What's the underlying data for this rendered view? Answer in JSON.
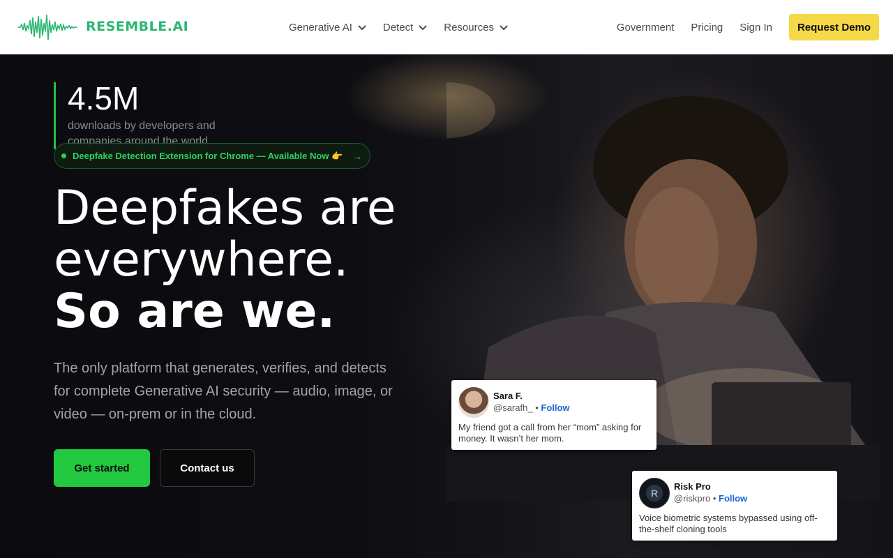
{
  "brand": {
    "name": "RESEMBLE.AI",
    "color": "#2bb673"
  },
  "nav": {
    "left": [
      {
        "label": "Generative AI",
        "has_dropdown": true
      },
      {
        "label": "Detect",
        "has_dropdown": true
      },
      {
        "label": "Resources",
        "has_dropdown": true
      }
    ],
    "right": [
      {
        "label": "Government"
      },
      {
        "label": "Pricing"
      },
      {
        "label": "Sign In"
      }
    ],
    "cta": {
      "label": "Request Demo",
      "color": "#f5d947"
    }
  },
  "hero": {
    "stat": {
      "value": "4.5M",
      "description": "downloads by developers and companies around the world"
    },
    "pill": {
      "text": "Deepfake Detection Extension for Chrome — Available Now 👉",
      "arrow": "→"
    },
    "headline": {
      "line1": "Deepfakes are",
      "line2": "everywhere.",
      "line3": "So are we."
    },
    "subtitle": "The only platform that generates, verifies, and detects for complete Generative AI security — audio, image, or video — on-prem or in the cloud.",
    "primary_button": "Get started",
    "secondary_button": "Contact us",
    "accent_color": "#22c83f"
  },
  "testimonials": [
    {
      "name": "Sara F.",
      "handle": "@sarafh_",
      "separator": "•",
      "follow": "Follow",
      "text": "My friend got a call from her “mom” asking for money. It wasn’t her mom."
    },
    {
      "name": "Risk Pro",
      "handle": "@riskpro",
      "separator": "•",
      "follow": "Follow",
      "text": "Voice biometric systems bypassed using off-the-shelf cloning tools"
    }
  ],
  "icons": [
    "waveform-logo-icon",
    "chevron-down-icon",
    "arrow-right-icon"
  ]
}
